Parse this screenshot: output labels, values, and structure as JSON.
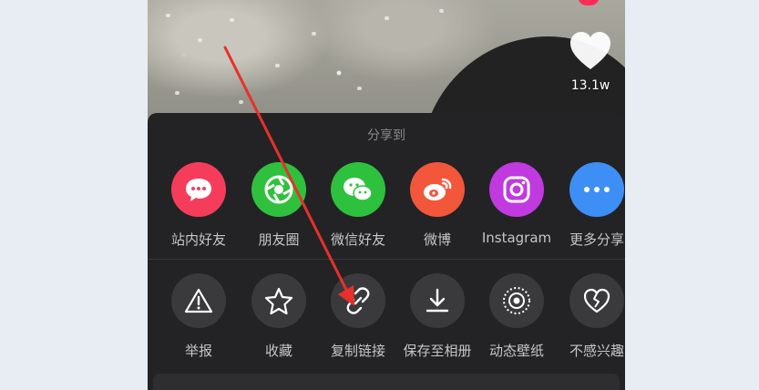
{
  "video": {
    "like_count": "13.1w"
  },
  "share_sheet": {
    "title": "分享到",
    "share_targets": [
      {
        "label": "站内好友",
        "icon": "chat-bubble-icon",
        "color": "#f53d5b"
      },
      {
        "label": "朋友圈",
        "icon": "moments-icon",
        "color": "#2fc13d"
      },
      {
        "label": "微信好友",
        "icon": "wechat-icon",
        "color": "#2dc13e"
      },
      {
        "label": "微博",
        "icon": "weibo-icon",
        "color": "#f2563b"
      },
      {
        "label": "Instagram",
        "icon": "instagram-icon",
        "color": "#c03ae0"
      },
      {
        "label": "更多分享",
        "icon": "more-icon",
        "color": "#3d8ff5"
      }
    ],
    "actions": [
      {
        "label": "举报",
        "icon": "warning-icon"
      },
      {
        "label": "收藏",
        "icon": "star-icon"
      },
      {
        "label": "复制链接",
        "icon": "link-icon"
      },
      {
        "label": "保存至相册",
        "icon": "download-icon"
      },
      {
        "label": "动态壁纸",
        "icon": "live-wallpaper-icon"
      },
      {
        "label": "不感兴趣",
        "icon": "broken-heart-icon"
      }
    ]
  },
  "annotation": {
    "color": "#e8302a"
  }
}
